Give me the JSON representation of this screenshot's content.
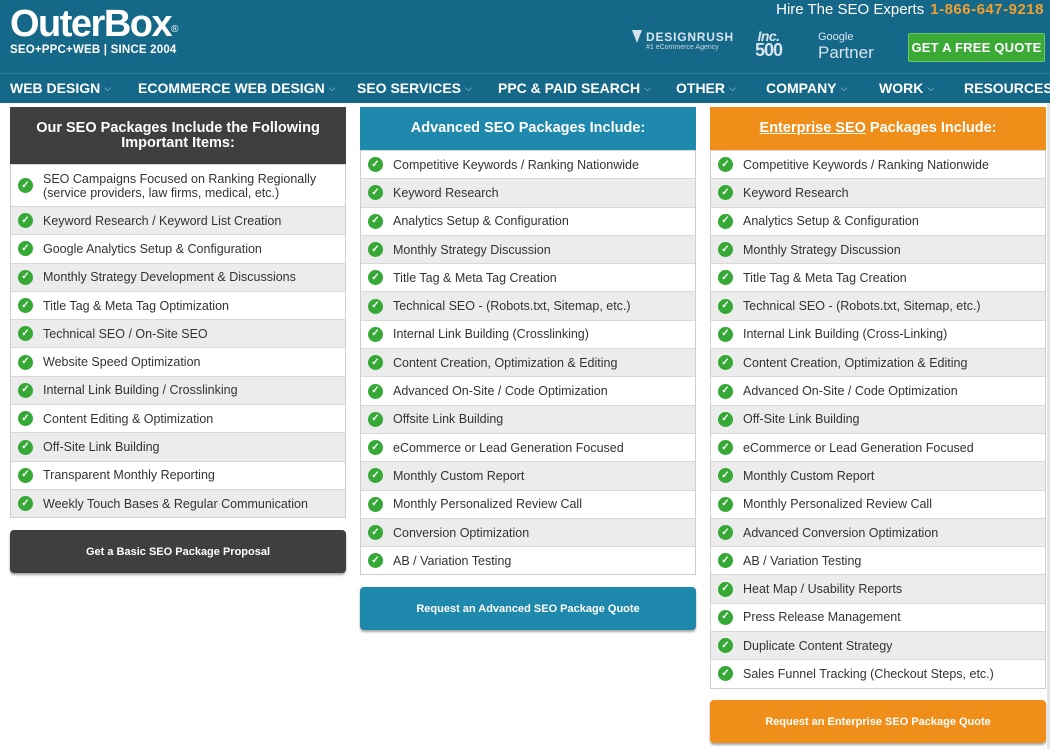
{
  "header": {
    "logo": "OuterBox",
    "logo_mark": "®",
    "tagline": "SEO+PPC+WEB | SINCE 2004",
    "hire_text": "Hire The SEO Experts",
    "phone": "1-866-647-9218",
    "designrush_name": "DESIGNRUSH",
    "designrush_sub": "#1 eCommerce Agency",
    "inc_top": "Inc.",
    "inc_num": "500",
    "google_top": "Google",
    "google_bottom": "Partner",
    "quote_button": "GET A FREE QUOTE"
  },
  "nav": [
    {
      "label": "WEB DESIGN",
      "dropdown": true
    },
    {
      "label": "ECOMMERCE WEB DESIGN",
      "dropdown": true
    },
    {
      "label": "SEO SERVICES",
      "dropdown": true
    },
    {
      "label": "PPC & PAID SEARCH",
      "dropdown": true
    },
    {
      "label": "OTHER",
      "dropdown": true
    },
    {
      "label": "COMPANY",
      "dropdown": true
    },
    {
      "label": "WORK",
      "dropdown": true
    },
    {
      "label": "RESOURCES",
      "dropdown": false
    }
  ],
  "columns": [
    {
      "title": "Our SEO Packages Include the Following Important Items:",
      "items": [
        "SEO Campaigns Focused on Ranking Regionally (service providers, law firms, medical, etc.)",
        "Keyword Research / Keyword List Creation",
        "Google Analytics Setup & Configuration",
        "Monthly Strategy Development & Discussions",
        "Title Tag & Meta Tag Optimization",
        "Technical SEO / On-Site SEO",
        "Website Speed Optimization",
        "Internal Link Building / Crosslinking",
        "Content Editing & Optimization",
        "Off-Site Link Building",
        "Transparent Monthly Reporting",
        "Weekly Touch Bases & Regular Communication"
      ],
      "cta": "Get a Basic SEO Package Proposal"
    },
    {
      "title": "Advanced SEO Packages Include:",
      "items": [
        "Competitive Keywords / Ranking Nationwide",
        "Keyword Research",
        "Analytics Setup & Configuration",
        "Monthly Strategy Discussion",
        "Title Tag & Meta Tag Creation",
        "Technical SEO - (Robots.txt, Sitemap, etc.)",
        "Internal Link Building (Crosslinking)",
        "Content Creation, Optimization & Editing",
        "Advanced On-Site / Code Optimization",
        "Offsite Link Building",
        "eCommerce or Lead Generation Focused",
        "Monthly Custom Report",
        "Monthly Personalized Review Call",
        "Conversion Optimization",
        "AB / Variation Testing"
      ],
      "cta": "Request an Advanced SEO Package Quote"
    },
    {
      "title_link": "Enterprise SEO",
      "title_rest": " Packages Include:",
      "items": [
        "Competitive Keywords / Ranking Nationwide",
        "Keyword Research",
        "Analytics Setup & Configuration",
        "Monthly Strategy Discussion",
        "Title Tag & Meta Tag Creation",
        "Technical SEO - (Robots.txt, Sitemap, etc.)",
        "Internal Link Building (Cross-Linking)",
        "Content Creation, Optimization & Editing",
        "Advanced On-Site / Code Optimization",
        "Off-Site Link Building",
        "eCommerce or Lead Generation Focused",
        "Monthly Custom Report",
        "Monthly Personalized Review Call",
        "Advanced Conversion Optimization",
        "AB / Variation Testing",
        "Heat Map / Usability Reports",
        "Press Release Management",
        "Duplicate Content Strategy",
        "Sales Funnel Tracking (Checkout Steps, etc.)"
      ],
      "cta": "Request an Enterprise SEO Package Quote"
    }
  ],
  "check_glyph": "✓",
  "chevron_glyph": "⌵",
  "colors": {
    "header_bg": "#156888",
    "basic": "#3f3f3f",
    "advanced": "#1f88ad",
    "enterprise": "#ef8f1a",
    "check": "#35a835",
    "quote_button": "#3ba935",
    "phone": "#f0a030"
  }
}
